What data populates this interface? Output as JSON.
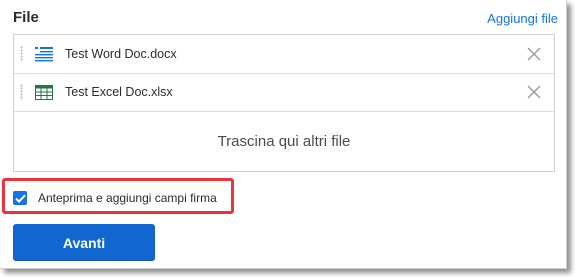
{
  "header": {
    "title": "File",
    "add_link_label": "Aggiungi file"
  },
  "files": [
    {
      "name": "Test Word Doc.docx",
      "icon": "word-document-icon"
    },
    {
      "name": "Test Excel Doc.xlsx",
      "icon": "excel-spreadsheet-icon"
    }
  ],
  "drop_zone": {
    "label": "Trascina qui altri file"
  },
  "preview_option": {
    "label": "Anteprima e aggiungi campi firma",
    "checked": true
  },
  "next_button": {
    "label": "Avanti"
  },
  "colors": {
    "accent": "#1473e6",
    "button": "#1266d0",
    "highlight": "#e8363c",
    "excel_green": "#1e7a45"
  }
}
